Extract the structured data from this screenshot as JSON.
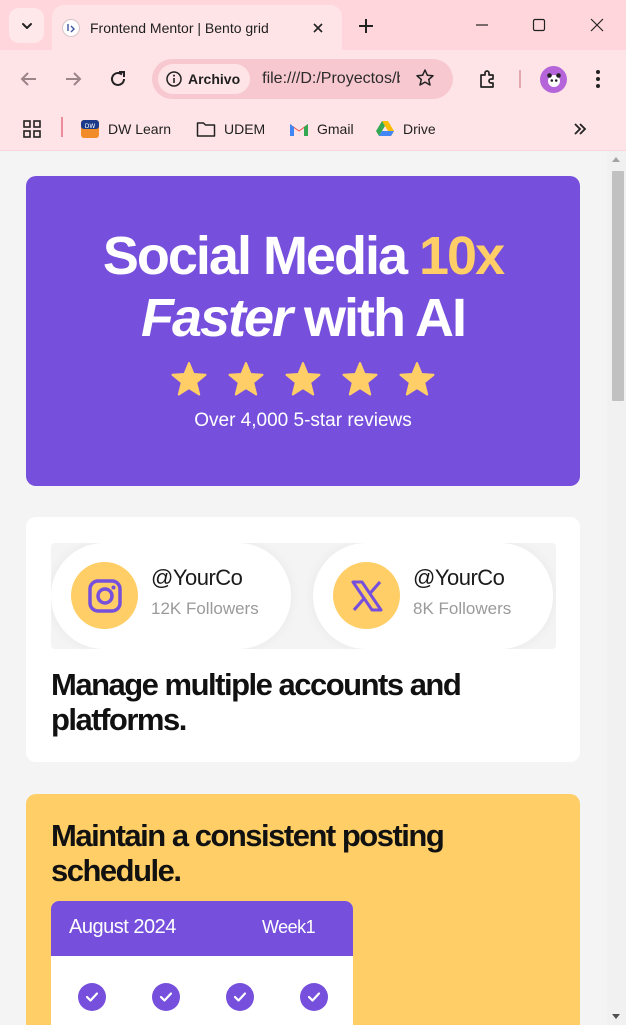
{
  "browser": {
    "tab_title": "Frontend Mentor | Bento grid",
    "security_chip": "Archivo",
    "url": "file:///D:/Proyectos/bento-grid/index.html",
    "bookmarks": [
      {
        "label": "DW Learn",
        "icon": "dw-learn-icon"
      },
      {
        "label": "UDEM",
        "icon": "folder-icon"
      },
      {
        "label": "Gmail",
        "icon": "gmail-icon"
      },
      {
        "label": "Drive",
        "icon": "drive-icon"
      }
    ]
  },
  "hero": {
    "line1_main": "Social Media ",
    "line1_accent": "10x",
    "line2_italic": "Faster",
    "line2_rest": " with AI",
    "stars": 5,
    "reviews": "Over 4,000 5-star reviews"
  },
  "accounts": {
    "items": [
      {
        "handle": "@YourCo",
        "followers": "12K Followers",
        "icon": "instagram-icon"
      },
      {
        "handle": "@YourCo",
        "followers": "8K Followers",
        "icon": "x-logo-icon"
      }
    ],
    "heading": "Manage multiple accounts and platforms."
  },
  "schedule": {
    "heading": "Maintain a consistent posting schedule.",
    "month": "August 2024",
    "week": "Week1",
    "checks": 4
  },
  "colors": {
    "purple": "#7650dc",
    "yellow": "#ffce67",
    "chrome_pink": "#ffd6dc"
  }
}
